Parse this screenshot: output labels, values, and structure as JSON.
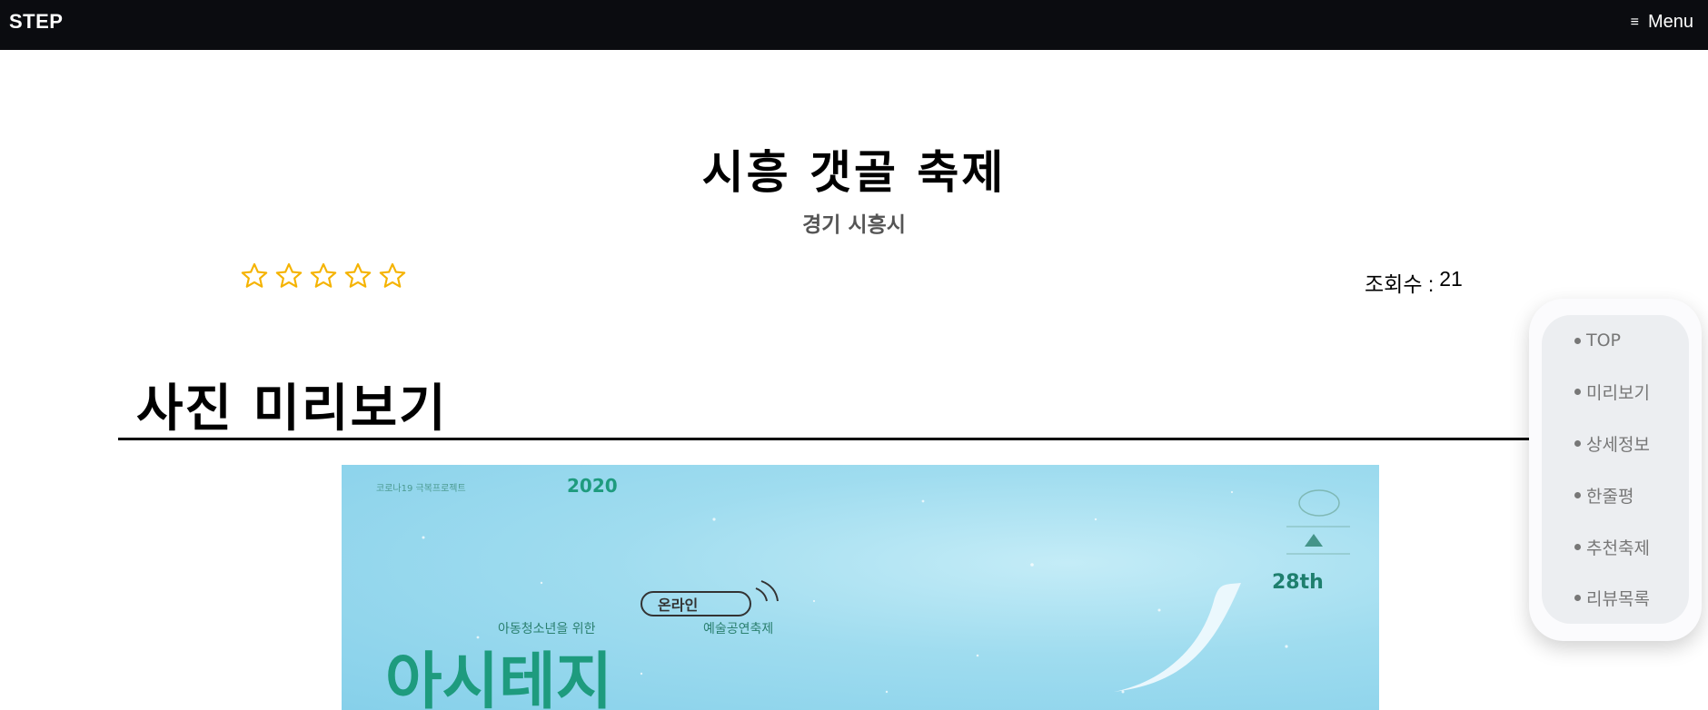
{
  "navbar": {
    "brand": "STEP",
    "menu_icon": "≡",
    "menu_label": "Menu"
  },
  "festival": {
    "title": "시흥 갯골 축제",
    "region": "경기 시흥시",
    "rating": {
      "value": 0,
      "max": 5
    },
    "views_label": "조회수 :",
    "views_count": "21"
  },
  "section": {
    "title": "사진 미리보기"
  },
  "poster": {
    "series": "코로나19 극복프로젝트",
    "year": "2020",
    "badge": "온라인",
    "tagline_left": "아동청소년을 위한",
    "tagline_right": "예술공연축제",
    "headline": "아시테지",
    "edition": "28th"
  },
  "sidenav": {
    "items": [
      {
        "label": "TOP"
      },
      {
        "label": "미리보기"
      },
      {
        "label": "상세정보"
      },
      {
        "label": "한줄평"
      },
      {
        "label": "추천축제"
      },
      {
        "label": "리뷰목록"
      }
    ]
  },
  "colors": {
    "navbar": "#0b0c10",
    "star": "#f5b300",
    "poster_sky": "#9fdcef",
    "poster_text": "#1e9b7e"
  }
}
